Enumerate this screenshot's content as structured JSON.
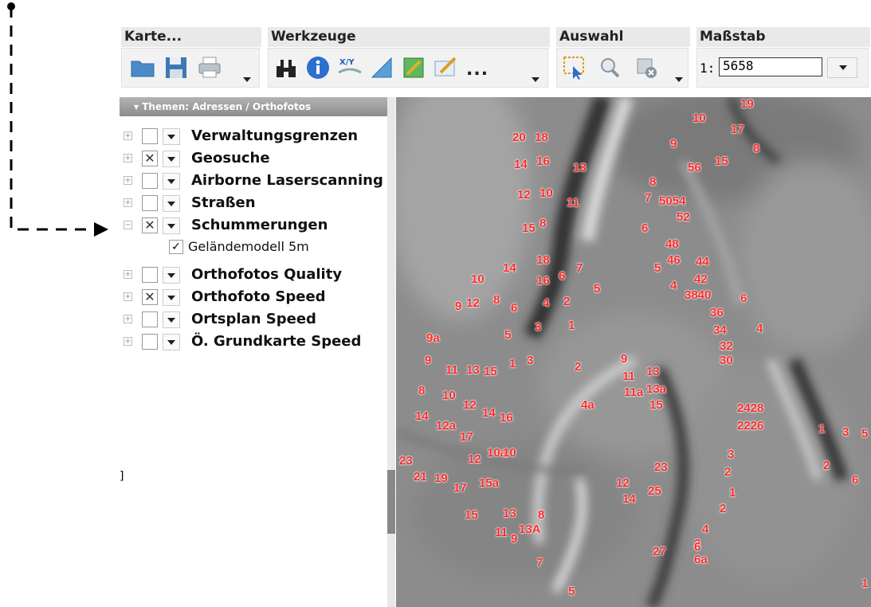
{
  "toolbar": {
    "groups": [
      {
        "title": "Karte..."
      },
      {
        "title": "Werkzeuge"
      },
      {
        "title": "Auswahl"
      },
      {
        "title": "Maßstab"
      }
    ],
    "scale_prefix": "1:",
    "scale_value": "5658",
    "more_label": "..."
  },
  "panel": {
    "title": "▾ Themen: Adressen / Orthofotos",
    "layers": [
      {
        "label": "Verwaltungsgrenzen",
        "checked": false,
        "expanded": false
      },
      {
        "label": "Geosuche",
        "checked": true,
        "expanded": false
      },
      {
        "label": "Airborne Laserscanning",
        "checked": false,
        "expanded": false
      },
      {
        "label": "Straßen",
        "checked": false,
        "expanded": false
      },
      {
        "label": "Schummerungen",
        "checked": true,
        "expanded": true
      },
      {
        "label": "Orthofotos Quality",
        "checked": false,
        "expanded": false
      },
      {
        "label": "Orthofoto Speed",
        "checked": true,
        "expanded": false
      },
      {
        "label": "Ortsplan Speed",
        "checked": false,
        "expanded": false
      },
      {
        "label": "Ö. Grundkarte Speed",
        "checked": false,
        "expanded": false
      }
    ],
    "sublayer": {
      "label": "Geländemodell 5m",
      "checked": true
    },
    "stray_text": "]"
  },
  "map": {
    "labels": [
      "19",
      "10",
      "17",
      "9",
      "8",
      "56",
      "15",
      "20",
      "18",
      "14",
      "16",
      "13",
      "8",
      "7",
      "5054",
      "12",
      "10",
      "11",
      "52",
      "15",
      "8",
      "6",
      "48",
      "18",
      "14",
      "5",
      "46",
      "44",
      "7",
      "10",
      "16",
      "6",
      "42",
      "5",
      "4",
      "3840",
      "6",
      "9",
      "12",
      "8",
      "6",
      "4",
      "2",
      "36",
      "3",
      "1",
      "34",
      "4",
      "9a",
      "5",
      "32",
      "9",
      "30",
      "11",
      "13",
      "15",
      "1",
      "3",
      "2",
      "9",
      "11",
      "13",
      "11a",
      "13a",
      "8",
      "10",
      "12",
      "14",
      "16",
      "4a",
      "15",
      "2428",
      "14",
      "12a",
      "17",
      "2226",
      "1",
      "3",
      "5",
      "12",
      "10a",
      "10",
      "3",
      "23",
      "23",
      "2",
      "2",
      "21",
      "19",
      "17",
      "15a",
      "12",
      "6",
      "1",
      "14",
      "25",
      "15",
      "13",
      "8",
      "2",
      "11",
      "13A",
      "9",
      "4",
      "2",
      "27",
      "6",
      "6a",
      "7",
      "5",
      "1"
    ]
  }
}
